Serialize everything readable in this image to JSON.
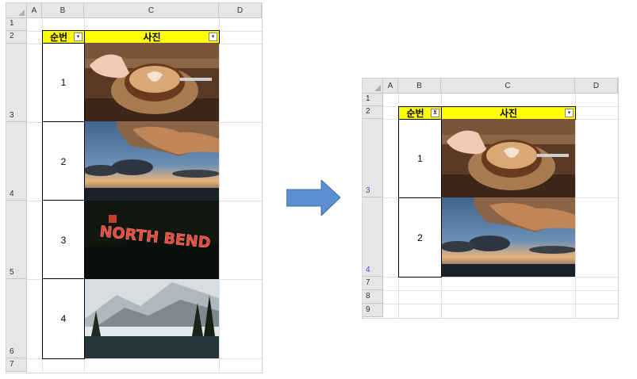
{
  "columns": [
    "A",
    "B",
    "C",
    "D"
  ],
  "header": {
    "seq_label": "순번",
    "photo_label": "사진"
  },
  "left": {
    "rows": [
      {
        "num": "1"
      },
      {
        "num": "2"
      },
      {
        "num": "3"
      },
      {
        "num": "4"
      },
      {
        "num": "5"
      },
      {
        "num": "6"
      },
      {
        "num": "7"
      }
    ],
    "items": [
      {
        "seq": "1",
        "photo": "latte-art-coffee"
      },
      {
        "seq": "2",
        "photo": "sunset-clouds-sea"
      },
      {
        "seq": "3",
        "photo": "north-bend-neon-sign"
      },
      {
        "seq": "4",
        "photo": "snowy-mountain-lake"
      }
    ],
    "photo3_text": "NORTH BEND"
  },
  "right": {
    "rows": [
      {
        "num": "1"
      },
      {
        "num": "2"
      },
      {
        "num": "3"
      },
      {
        "num": "4"
      },
      {
        "num": "7"
      },
      {
        "num": "8"
      },
      {
        "num": "9"
      }
    ],
    "items": [
      {
        "seq": "1",
        "photo": "latte-art-coffee"
      },
      {
        "seq": "2",
        "photo": "sunset-clouds-sea"
      }
    ]
  },
  "colors": {
    "header_fill": "#ffff00",
    "arrow": "#5b8fd1",
    "filtered_row": "#2b56c7"
  },
  "icons": {
    "dropdown": "chevron-down-icon",
    "filter_active": "filter-icon",
    "corner": "select-all-icon",
    "arrow": "right-arrow-icon"
  }
}
